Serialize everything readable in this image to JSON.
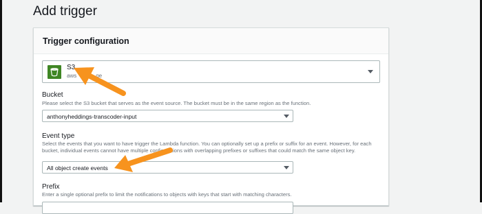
{
  "page": {
    "title": "Add trigger"
  },
  "panel": {
    "title": "Trigger configuration"
  },
  "service": {
    "name": "S3",
    "subtitle": "aws",
    "subtitle_tail": "ge",
    "icon": "s3-bucket-icon"
  },
  "bucket": {
    "label": "Bucket",
    "description": "Please select the S3 bucket that serves as the event source. The bucket must be in the same region as the function.",
    "value": "anthonyheddings-transcoder-input"
  },
  "event_type": {
    "label": "Event type",
    "description": "Select the events that you want to have trigger the Lambda function. You can optionally set up a prefix or suffix for an event. However, for each bucket, individual events cannot have multiple configurations with overlapping prefixes or suffixes that could match the same object key.",
    "value": "All object create events"
  },
  "prefix": {
    "label": "Prefix",
    "description": "Enter a single optional prefix to limit the notifications to objects with keys that start with matching characters."
  },
  "colors": {
    "accent_arrow": "#f7931e",
    "s3_green": "#3f8624"
  }
}
